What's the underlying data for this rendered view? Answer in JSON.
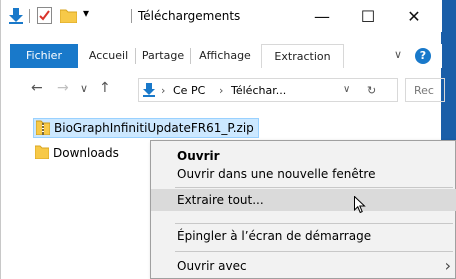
{
  "window": {
    "title": "Téléchargements"
  },
  "window_controls": {
    "minimize": "—",
    "maximize": "☐",
    "close": "✕"
  },
  "ribbon": {
    "tabs": [
      {
        "label": "Fichier"
      },
      {
        "label": "Accueil"
      },
      {
        "label": "Partage"
      },
      {
        "label": "Affichage"
      },
      {
        "label": "Extraction"
      }
    ],
    "help": "?"
  },
  "address": {
    "segments": [
      "Ce PC",
      "Téléchar..."
    ],
    "search_placeholder": "Rec"
  },
  "files": [
    {
      "name": "BioGraphInfinitiUpdateFR61_P.zip",
      "icon": "zip-folder-icon",
      "selected": true
    },
    {
      "name": "Downloads",
      "icon": "folder-icon",
      "selected": false
    }
  ],
  "context_menu": {
    "items": [
      {
        "label": "Ouvrir",
        "bold": true
      },
      {
        "label": "Ouvrir dans une nouvelle fenêtre"
      },
      {
        "label": "Extraire tout...",
        "highlighted": true
      },
      {
        "label": "Épingler à l’écran de démarrage"
      },
      {
        "label": "Ouvrir avec",
        "submenu": true
      }
    ]
  },
  "colors": {
    "accent": "#1979ca",
    "selection_bg": "#cce8ff",
    "menu_highlight": "#dadada",
    "desktop": "#1a5ea8"
  }
}
